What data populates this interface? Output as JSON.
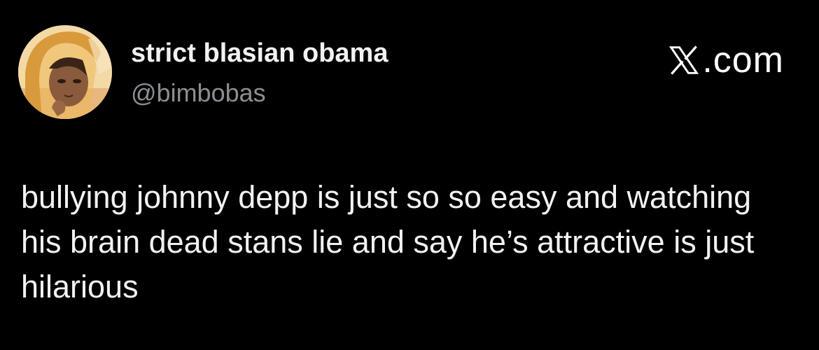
{
  "author": {
    "display_name": "strict blasian obama",
    "handle": "@bimbobas",
    "avatar_icon": "illustrated-avatar"
  },
  "branding": {
    "icon": "x-logo-icon",
    "domain_suffix": ".com"
  },
  "tweet": {
    "text": "bullying johnny depp is just so so easy and watching his brain dead stans lie and say he’s attractive is just hilarious"
  },
  "colors": {
    "background": "#000000",
    "text_primary": "#f2f2f2",
    "text_secondary": "#8b8f94"
  }
}
